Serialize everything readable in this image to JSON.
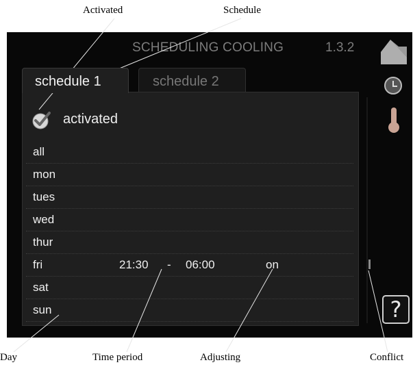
{
  "callouts": {
    "activated": "Activated",
    "schedule": "Schedule",
    "day": "Day",
    "time_period": "Time period",
    "adjusting": "Adjusting",
    "conflict": "Conflict"
  },
  "header": {
    "title": "SCHEDULING COOLING",
    "menu_number": "1.3.2"
  },
  "tabs": [
    {
      "label": "schedule 1",
      "active": true
    },
    {
      "label": "schedule 2",
      "active": false
    }
  ],
  "activated": {
    "label": "activated",
    "checked": true
  },
  "days": [
    {
      "day": "all",
      "start": "",
      "dash": "",
      "end": "",
      "setting": ""
    },
    {
      "day": "mon",
      "start": "",
      "dash": "",
      "end": "",
      "setting": ""
    },
    {
      "day": "tues",
      "start": "",
      "dash": "",
      "end": "",
      "setting": ""
    },
    {
      "day": "wed",
      "start": "",
      "dash": "",
      "end": "",
      "setting": ""
    },
    {
      "day": "thur",
      "start": "",
      "dash": "",
      "end": "",
      "setting": ""
    },
    {
      "day": "fri",
      "start": "21:30",
      "dash": "-",
      "end": "06:00",
      "setting": "on"
    },
    {
      "day": "sat",
      "start": "",
      "dash": "",
      "end": "",
      "setting": ""
    },
    {
      "day": "sun",
      "start": "",
      "dash": "",
      "end": "",
      "setting": ""
    }
  ],
  "help": {
    "label": "?"
  },
  "icons": [
    "house-icon",
    "clock-icon",
    "thermometer-icon",
    "help-icon",
    "checkmark-icon"
  ]
}
